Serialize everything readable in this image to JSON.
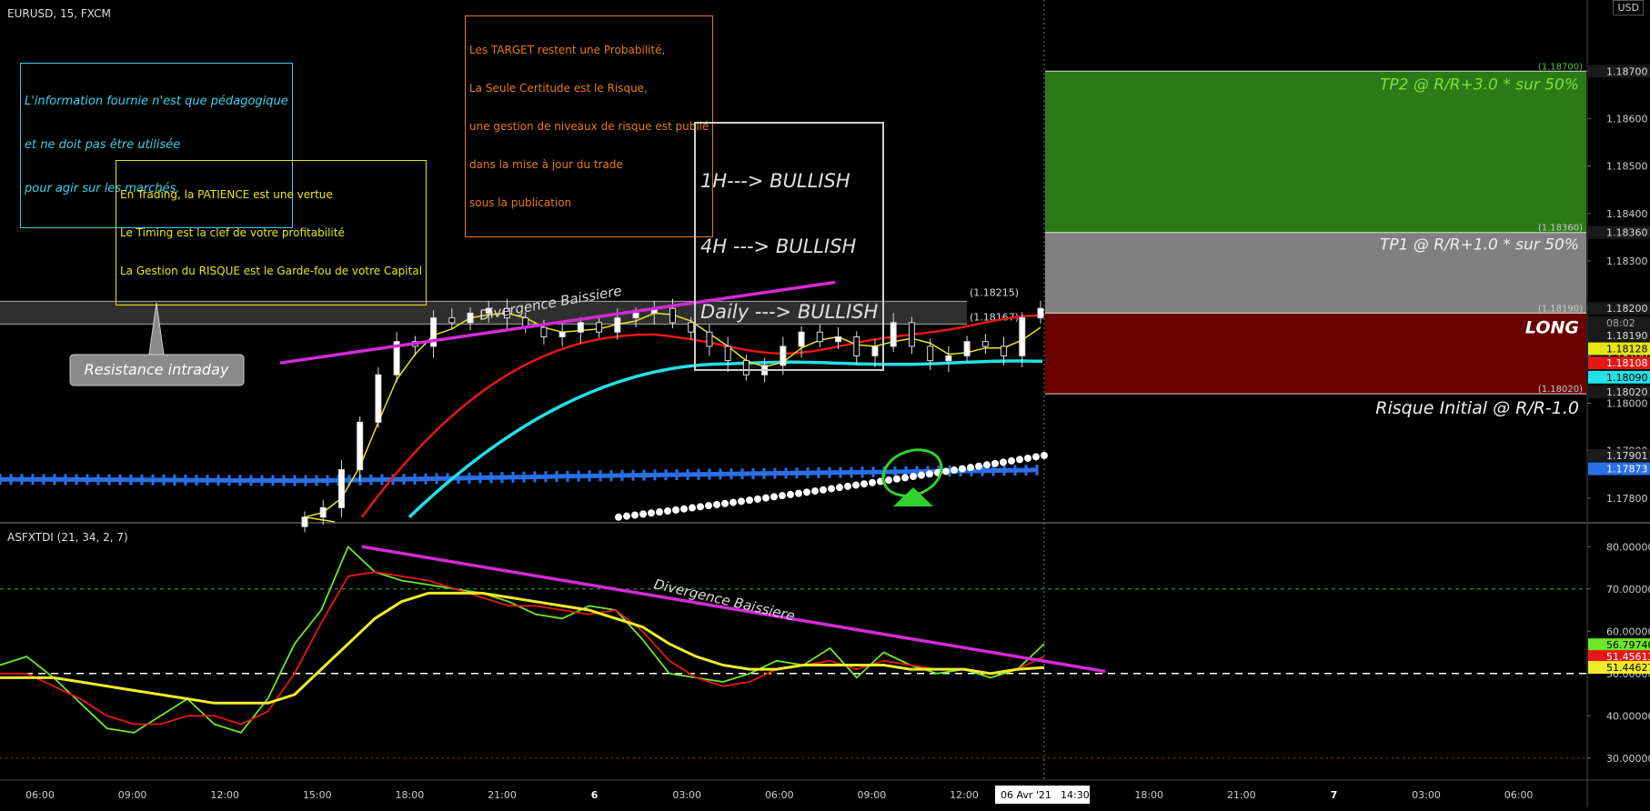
{
  "header": {
    "symbol": "EURUSD, 15, FXCM",
    "currency": "USD"
  },
  "subpanel_title": "ASFXTDI (21, 34, 2, 7)",
  "notes": {
    "pedagogic": [
      "L'information fournie n'est que pédagogique",
      "et ne doit pas être utilisée",
      "pour agir sur les marchés."
    ],
    "trading": [
      "En Trading, la PATIENCE est une vertue",
      "Le Timing est la clef de votre profitabilité",
      "La Gestion du RISQUE est le Garde-fou de votre Capital"
    ],
    "target": [
      "Les TARGET restent une Probabilité,",
      "La Seule Certitude est le Risque,",
      "une gestion de niveaux de risque est publié",
      "dans la mise à jour du trade",
      "sous la publication"
    ],
    "bias": [
      "1H---> BULLISH",
      "4H ---> BULLISH",
      "Daily ---> BULLISH"
    ]
  },
  "labels": {
    "resistance": "Resistance intraday",
    "divergence_price": "Divergence Baissiere",
    "divergence_ind": "Divergence Baissiere",
    "tp2": "TP2 @ R/R+3.0 * sur 50%",
    "tp1": "TP1 @ R/R+1.0 * sur 50%",
    "long": "LONG",
    "risk": "Risque Initial @ R/R-1.0",
    "zone_top_tp2": "(1.18700)",
    "zone_top_tp1": "(1.18360)",
    "zone_entry": "(1.18190)",
    "zone_stop": "(1.18020)",
    "res_high": "(1.18215)",
    "res_low": "(1.18167)",
    "time_cursor": "06 Avr '21",
    "time_cursor2": "14:30"
  },
  "colors": {
    "bg": "#000000",
    "tp2_zone": "#2a7a16",
    "tp1_zone": "#808080",
    "risk_zone": "#6b0000",
    "ema_fast": "#e6e617",
    "ema_mid": "#e61717",
    "ema_slow": "#22e0e6",
    "ma_blue": "#2a6fe6",
    "ma_white": "#ffffff",
    "magenta": "#d32ad8",
    "tdi_green": "#6ee62a",
    "tdi_red": "#e61717",
    "tdi_yellow": "#f0ec2a"
  },
  "price_axis": {
    "ticks": [
      "1.18700",
      "1.18600",
      "1.18500",
      "1.18400",
      "1.18300",
      "1.18200",
      "1.18100",
      "1.18000",
      "1.17900",
      "1.17800"
    ],
    "badges": [
      {
        "text": "1.18700",
        "color": "#1a1a1a",
        "fg": "#ddd",
        "value": 1.187
      },
      {
        "text": "1.18360",
        "color": "#1a1a1a",
        "fg": "#ddd",
        "value": 1.1836
      },
      {
        "text": "1.18200",
        "color": "#1a1a1a",
        "fg": "#ddd",
        "value": 1.182
      },
      {
        "text": "08:02",
        "color": "#1a1a1a",
        "fg": "#aaa",
        "value": 1.1817
      },
      {
        "text": "1.18190",
        "color": "#1a1a1a",
        "fg": "#ddd",
        "value": 1.18143
      },
      {
        "text": "1.18128",
        "color": "#e6e617",
        "fg": "#000",
        "value": 1.18115
      },
      {
        "text": "1.18108",
        "color": "#e61717",
        "fg": "#fff",
        "value": 1.18085
      },
      {
        "text": "1.18090",
        "color": "#22e0e6",
        "fg": "#000",
        "value": 1.18055
      },
      {
        "text": "1.18020",
        "color": "#1a1a1a",
        "fg": "#ddd",
        "value": 1.18024
      },
      {
        "text": "1.17901",
        "color": "#1a1a1a",
        "fg": "#ddd",
        "value": 1.1789
      },
      {
        "text": "1.17873",
        "color": "#2a6fe6",
        "fg": "#fff",
        "value": 1.17862
      }
    ]
  },
  "indicator_axis": {
    "ticks": [
      "80.00000",
      "70.00000",
      "60.00000",
      "50.00000",
      "40.00000",
      "30.00000"
    ],
    "badges": [
      {
        "text": "56.79740",
        "color": "#6ee62a",
        "fg": "#000",
        "value": 56.8
      },
      {
        "text": "51.45613",
        "color": "#e61717",
        "fg": "#fff",
        "value": 54.0
      },
      {
        "text": "51.44627",
        "color": "#f0ec2a",
        "fg": "#000",
        "value": 51.45
      }
    ]
  },
  "time_axis": [
    "06:00",
    "09:00",
    "12:00",
    "15:00",
    "18:00",
    "21:00",
    "6",
    "03:00",
    "06:00",
    "09:00",
    "12:00",
    "15:00",
    "18:00",
    "21:00",
    "7",
    "03:00",
    "06:00"
  ],
  "chart_data": [
    {
      "type": "line",
      "title": "EURUSD, 15, FXCM",
      "ylim": [
        1.1775,
        1.1885
      ],
      "levels": {
        "tp2": 1.187,
        "tp1": 1.1836,
        "entry": 1.1819,
        "stop": 1.1802,
        "resistance_high": 1.18215,
        "resistance_low": 1.18167
      },
      "candles_close": [
        1.1776,
        1.1778,
        1.1786,
        1.1796,
        1.1806,
        1.1813,
        1.1812,
        1.1818,
        1.1817,
        1.1819,
        1.182,
        1.1818,
        1.1816,
        1.1814,
        1.1815,
        1.1817,
        1.1815,
        1.1818,
        1.1819,
        1.182,
        1.1817,
        1.1815,
        1.1812,
        1.1809,
        1.1806,
        1.1808,
        1.1812,
        1.1815,
        1.1813,
        1.1814,
        1.181,
        1.1812,
        1.1817,
        1.1812,
        1.1809,
        1.181,
        1.1813,
        1.1812,
        1.181,
        1.1818,
        1.182
      ]
    },
    {
      "type": "line",
      "title": "ASFXTDI (21, 34, 2, 7)",
      "ylim": [
        25,
        85
      ],
      "levels": [
        70,
        50,
        30
      ],
      "series": [
        {
          "color": "green",
          "values": [
            52,
            54,
            49,
            43,
            37,
            36,
            40,
            44,
            38,
            36,
            44,
            57,
            65,
            80,
            74,
            72,
            71,
            70,
            69,
            67,
            64,
            63,
            66,
            65,
            58,
            50,
            49,
            48,
            50,
            53,
            52,
            56,
            49,
            55,
            52,
            50,
            51,
            49,
            51,
            57
          ]
        },
        {
          "color": "red",
          "values": [
            50,
            50,
            47,
            44,
            40,
            38,
            38,
            40,
            40,
            38,
            41,
            50,
            62,
            73,
            74,
            73,
            72,
            70,
            68,
            66,
            66,
            65,
            64,
            65,
            60,
            53,
            49,
            47,
            48,
            51,
            52,
            53,
            51,
            53,
            52,
            51,
            51,
            50,
            51,
            54
          ]
        },
        {
          "color": "yellow",
          "values": [
            49,
            49,
            49,
            48,
            47,
            46,
            45,
            44,
            43,
            43,
            43,
            45,
            51,
            57,
            63,
            67,
            69,
            69,
            69,
            68,
            67,
            66,
            65,
            63,
            61,
            57,
            54,
            52,
            51,
            51,
            52,
            52,
            52,
            52,
            51,
            51,
            51,
            50,
            51,
            51.4
          ]
        }
      ]
    }
  ]
}
